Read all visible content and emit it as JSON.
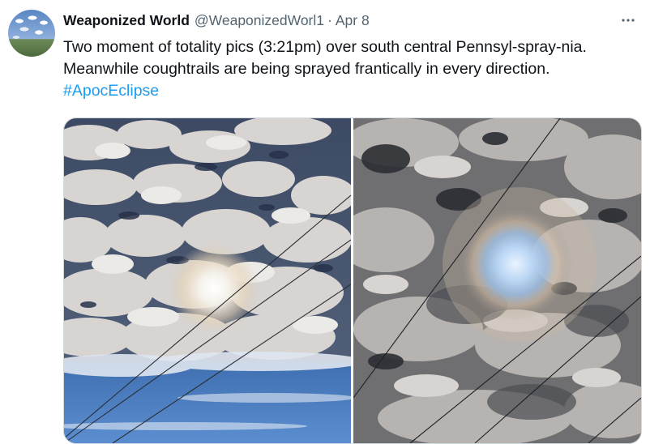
{
  "tweet": {
    "author_name": "Weaponized World",
    "handle": "@WeaponizedWorl1",
    "separator": "·",
    "date": "Apr 8",
    "text_lines": [
      "Two moment of totality pics (3:21pm) over south central Pennsyl-spray-nia.",
      "Meanwhile coughtrails are being sprayed frantically in every direction."
    ],
    "hashtag": "#ApocEclipse"
  },
  "colors": {
    "link": "#1d9bf0",
    "muted_text": "#536471",
    "main_text": "#0f1419"
  },
  "icons": {
    "more": "more-horizontal-icon",
    "avatar": "avatar-sky-image"
  }
}
